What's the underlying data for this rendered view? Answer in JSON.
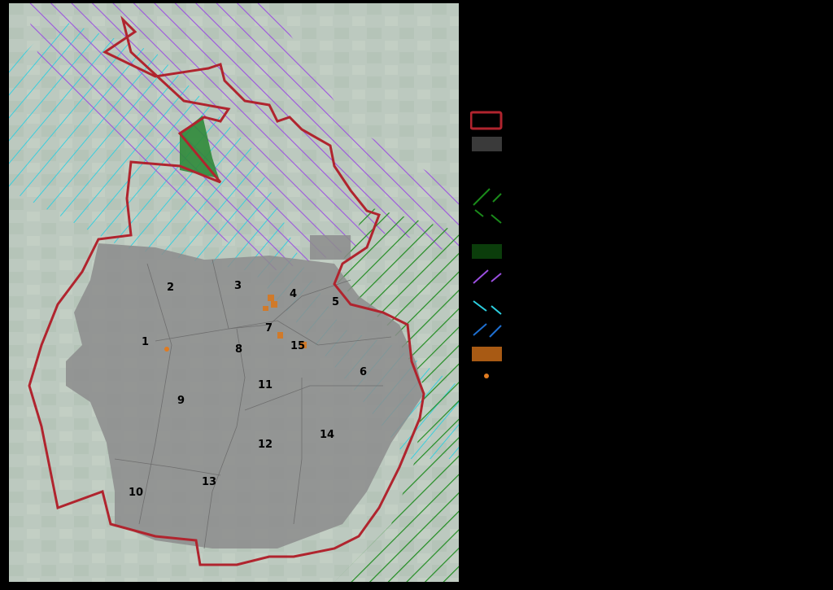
{
  "map": {
    "districts": [
      {
        "id": "1",
        "label": "1"
      },
      {
        "id": "2",
        "label": "2"
      },
      {
        "id": "3",
        "label": "3"
      },
      {
        "id": "4",
        "label": "4"
      },
      {
        "id": "5",
        "label": "5"
      },
      {
        "id": "6",
        "label": "6"
      },
      {
        "id": "7",
        "label": "7"
      },
      {
        "id": "8",
        "label": "8"
      },
      {
        "id": "9",
        "label": "9"
      },
      {
        "id": "10",
        "label": "10"
      },
      {
        "id": "11",
        "label": "11"
      },
      {
        "id": "12",
        "label": "12"
      },
      {
        "id": "13",
        "label": "13"
      },
      {
        "id": "14",
        "label": "14"
      },
      {
        "id": "15",
        "label": "15"
      }
    ],
    "colors": {
      "boundary": "#b0242e",
      "built_area": "#8c8c8c",
      "hatch_green": "#1a8a1a",
      "hatch_purple": "#9b4fe0",
      "hatch_cyan": "#2ccfe0",
      "hatch_blue": "#1e6fd0",
      "dark_green": "#0b3d0b",
      "orange": "#c8661a",
      "point_orange": "#e07b20",
      "satellite_base": "#a9b7ad"
    }
  },
  "legend": {
    "items": [
      {
        "icon": "boundary-outline-icon",
        "color": "#b0242e"
      },
      {
        "icon": "built-area-fill-icon",
        "color": "#3a3a3a"
      },
      {
        "icon": "green-dash-hatch-icon",
        "color": "#1a8a1a"
      },
      {
        "icon": "dark-green-fill-icon",
        "color": "#0b3d0b"
      },
      {
        "icon": "purple-hatch-icon",
        "color": "#9b4fe0"
      },
      {
        "icon": "cyan-blue-hatch-icon",
        "color": "#2ccfe0"
      },
      {
        "icon": "orange-fill-icon",
        "color": "#a85a14"
      },
      {
        "icon": "orange-point-icon",
        "color": "#e07b20"
      }
    ]
  }
}
